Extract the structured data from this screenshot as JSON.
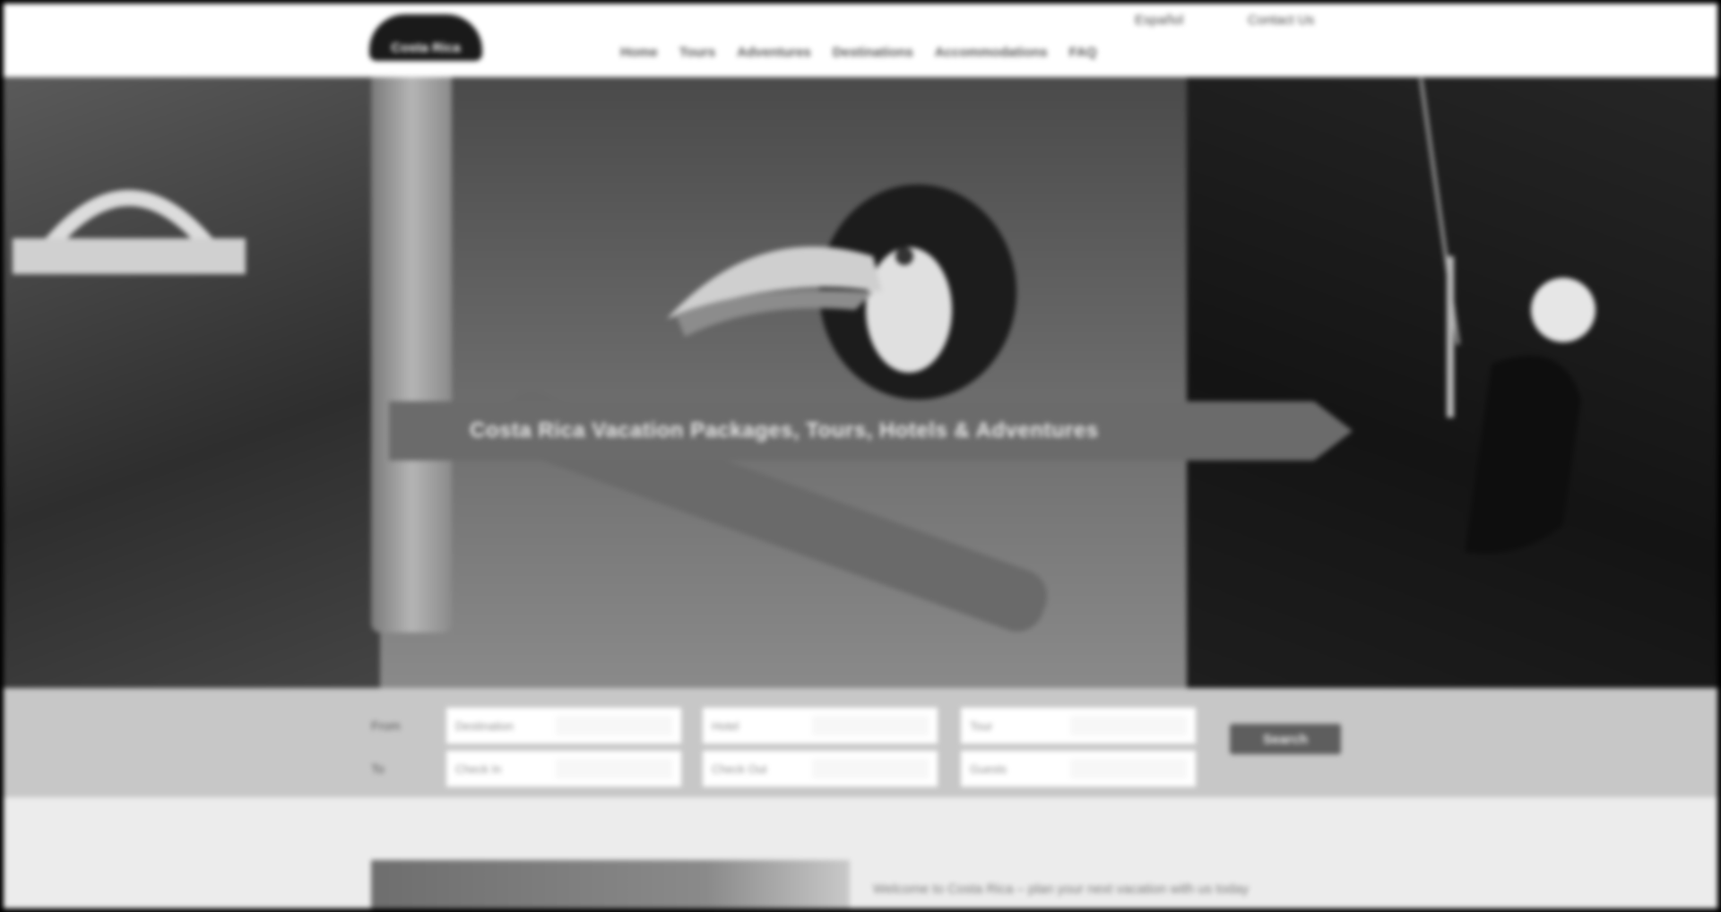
{
  "site": {
    "logo_text": "Costa Rica",
    "top_links": [
      "Español",
      "Contact Us"
    ]
  },
  "nav": {
    "items": [
      "Home",
      "Tours",
      "Adventures",
      "Destinations",
      "Accommodations",
      "FAQ"
    ]
  },
  "hero": {
    "banner_text": "Costa Rica Vacation Packages, Tours, Hotels & Adventures"
  },
  "search": {
    "row_labels": [
      "From",
      "To"
    ],
    "fields": [
      {
        "placeholder": "Destination"
      },
      {
        "placeholder": "Hotel"
      },
      {
        "placeholder": "Tour"
      },
      {
        "placeholder": "Check In"
      },
      {
        "placeholder": "Check Out"
      },
      {
        "placeholder": "Guests"
      }
    ],
    "button_label": "Search"
  },
  "content": {
    "promo_text": "Welcome to Costa Rica – plan your next vacation with us today"
  },
  "colors": {
    "header_bg": "#ffffff",
    "search_bar_bg": "#c7c7c7",
    "banner_bg": "#6b6b6b"
  }
}
